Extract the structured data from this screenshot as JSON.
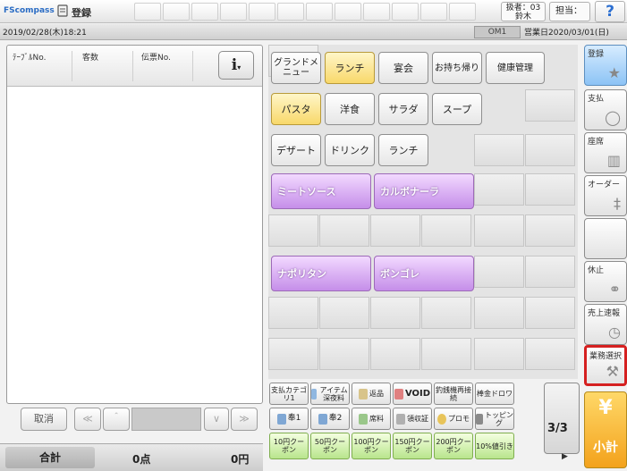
{
  "header": {
    "logo": "FScompass",
    "screen_title": "登録",
    "staff_label": "扱者：03",
    "staff_name": "鈴木",
    "tanto_label": "担当：",
    "help_symbol": "?"
  },
  "datebar": {
    "datetime": "2019/02/28(木)18:21",
    "om_label": "OM1",
    "business_date": "営業日2020/03/01(日)"
  },
  "order_list": {
    "columns": [
      "ﾃｰﾌﾞﾙNo.",
      "客数",
      "伝票No."
    ],
    "info_symbol": "i"
  },
  "nav": {
    "cancel": "取消",
    "first": "≪",
    "prev": "＾",
    "next": "∨",
    "last": "≫"
  },
  "totals": {
    "label": "合計",
    "count": "0点",
    "amount": "0円"
  },
  "categories_row1": [
    "グランドメニュー",
    "ランチ",
    "宴会",
    "お持ち帰り",
    "健康管理"
  ],
  "categories_row2": [
    "パスタ",
    "洋食",
    "サラダ",
    "スープ"
  ],
  "categories_row3": [
    "デザート",
    "ドリンク",
    "ランチ"
  ],
  "menu_items": [
    "ミートソース",
    "カルボナーラ",
    "ナポリタン",
    "ボンゴレ"
  ],
  "function_row1": [
    "支払カテゴリ1",
    "アイテム深夜料",
    "返品",
    "VOID",
    "釣銭機再接続",
    "棒金ドロワ"
  ],
  "function_row2": [
    "奉1",
    "奉2",
    "席料",
    "領収証",
    "プロモ",
    "トッピング"
  ],
  "function_row3": [
    "10円クーポン",
    "50円クーポン",
    "100円クーポン",
    "150円クーポン",
    "200円クーポン",
    "10%値引き"
  ],
  "page_indicator": "3/3",
  "page_arrow": "▶",
  "sidebar": [
    "登録",
    "支払",
    "座席",
    "オーダー",
    "",
    "休止",
    "売上速報",
    "業務選択"
  ],
  "subtotal": {
    "symbol": "¥",
    "label": "小計"
  },
  "colors": {
    "selected": "#f8d86a",
    "menu_item": "#c58ee9",
    "sidebar_active": "#8cc3f5",
    "subtotal": "#f3a21c",
    "highlight_border": "#d52020"
  }
}
